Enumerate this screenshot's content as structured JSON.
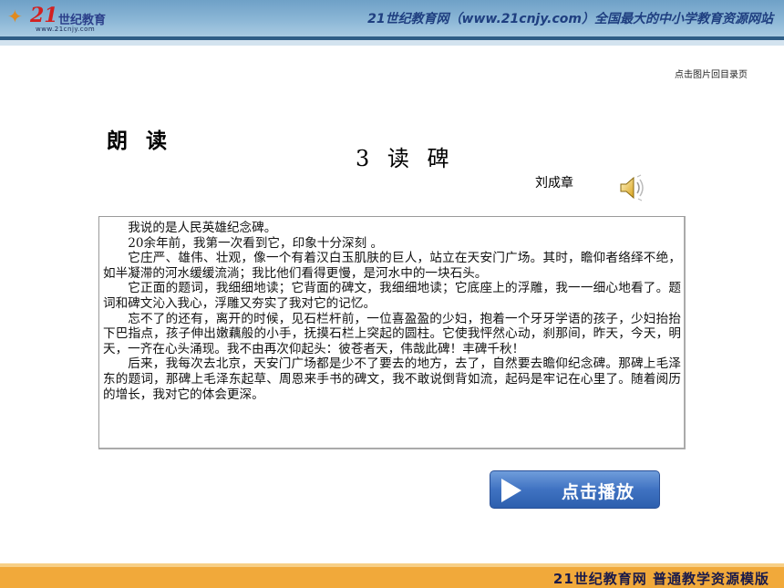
{
  "header": {
    "logo_number": "21",
    "logo_name": "世纪教育",
    "logo_url": "www.21cnjy.com",
    "slogan": "21世纪教育网（www.21cnjy.com）全国最大的中小学教育资源网站"
  },
  "nav": {
    "back_to_menu": "点击图片回目录页"
  },
  "section_title": "朗 读",
  "lesson": {
    "title": "3 读 碑",
    "author": "刘成章"
  },
  "passage": [
    "我说的是人民英雄纪念碑。",
    "20余年前，我第一次看到它，印象十分深刻 。",
    "它庄严、雄伟、壮观，像一个有着汉白玉肌肤的巨人，站立在天安门广场。其时，瞻仰者络绎不绝，如半凝滞的河水缓缓流淌；我比他们看得更慢，是河水中的一块石头。",
    "它正面的题词，我细细地读；它背面的碑文，我细细地读；它底座上的浮雕，我一一细心地看了。题词和碑文沁入我心，浮雕又夯实了我对它的记忆。",
    "忘不了的还有，离开的时候，见石栏杆前，一位喜盈盈的少妇，抱着一个牙牙学语的孩子，少妇抬抬下巴指点，孩子伸出嫩藕般的小手，抚摸石栏上突起的圆柱。它使我怦然心动，刹那间，昨天，今天，明天，一齐在心头涌现。我不由再次仰起头：彼苍者天，伟哉此碑！丰碑千秋！",
    "后来，我每次去北京，天安门广场都是少不了要去的地方，去了，自然要去瞻仰纪念碑。那碑上毛泽东的题词，那碑上毛泽东起草、周恩来手书的碑文，我不敢说倒背如流，起码是牢记在心里了。随着阅历的增长，我对它的体会更深。"
  ],
  "play_button": {
    "label": "点击播放",
    "icon": "play-icon"
  },
  "speaker": {
    "icon": "speaker-icon"
  },
  "footer": {
    "text": "21世纪教育网   普通教学资源模版"
  },
  "colors": {
    "header_blue": "#8bb6d6",
    "button_blue": "#3f72c2",
    "footer_orange": "#f1a93a"
  }
}
